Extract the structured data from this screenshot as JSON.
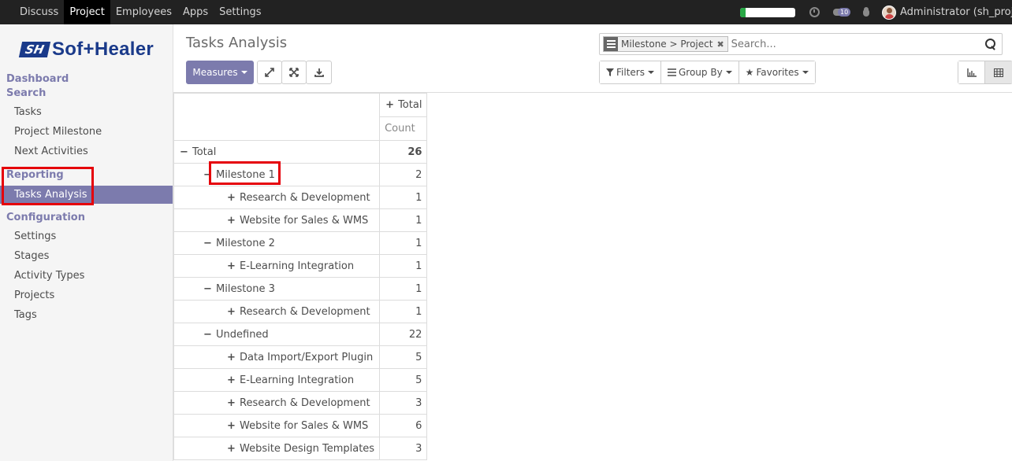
{
  "topbar": {
    "menu": [
      {
        "label": "Discuss",
        "active": false
      },
      {
        "label": "Project",
        "active": true
      },
      {
        "label": "Employees",
        "active": false
      },
      {
        "label": "Apps",
        "active": false
      },
      {
        "label": "Settings",
        "active": false
      }
    ],
    "progress_fraction": 0.1,
    "message_badge": "10",
    "user_label": "Administrator (sh_proje..."
  },
  "sidebar": {
    "logo_mark": "SH",
    "logo_text": "Sof+Healer",
    "sections": [
      {
        "label": "Dashboard"
      },
      {
        "label": "Search"
      },
      {
        "label": "Reporting"
      },
      {
        "label": "Configuration"
      }
    ],
    "search_items": [
      "Tasks",
      "Project Milestone",
      "Next Activities"
    ],
    "reporting_items": [
      "Tasks Analysis"
    ],
    "config_items": [
      "Settings",
      "Stages",
      "Activity Types",
      "Projects",
      "Tags"
    ]
  },
  "controlpanel": {
    "title": "Tasks Analysis",
    "measures_label": "Measures",
    "search_facet": "Milestone > Project",
    "search_placeholder": "Search...",
    "filters_label": "Filters",
    "groupby_label": "Group By",
    "favorites_label": "Favorites"
  },
  "pivot": {
    "col_header": "Total",
    "measure_header": "Count",
    "rows": [
      {
        "label": "Total",
        "value": "26",
        "level": 0,
        "sign": "−"
      },
      {
        "label": "Milestone 1",
        "value": "2",
        "level": 1,
        "sign": "−"
      },
      {
        "label": "Research & Development",
        "value": "1",
        "level": 2,
        "sign": "+"
      },
      {
        "label": "Website for Sales & WMS",
        "value": "1",
        "level": 2,
        "sign": "+"
      },
      {
        "label": "Milestone 2",
        "value": "1",
        "level": 1,
        "sign": "−"
      },
      {
        "label": "E-Learning Integration",
        "value": "1",
        "level": 2,
        "sign": "+"
      },
      {
        "label": "Milestone 3",
        "value": "1",
        "level": 1,
        "sign": "−"
      },
      {
        "label": "Research & Development",
        "value": "1",
        "level": 2,
        "sign": "+"
      },
      {
        "label": "Undefined",
        "value": "22",
        "level": 1,
        "sign": "−"
      },
      {
        "label": "Data Import/Export Plugin",
        "value": "5",
        "level": 2,
        "sign": "+"
      },
      {
        "label": "E-Learning Integration",
        "value": "5",
        "level": 2,
        "sign": "+"
      },
      {
        "label": "Research & Development",
        "value": "3",
        "level": 2,
        "sign": "+"
      },
      {
        "label": "Website for Sales & WMS",
        "value": "6",
        "level": 2,
        "sign": "+"
      },
      {
        "label": "Website Design Templates",
        "value": "3",
        "level": 2,
        "sign": "+"
      }
    ]
  },
  "colors": {
    "accent": "#7c7bad",
    "topbar": "#222222",
    "highlight_box": "#e5000a"
  }
}
